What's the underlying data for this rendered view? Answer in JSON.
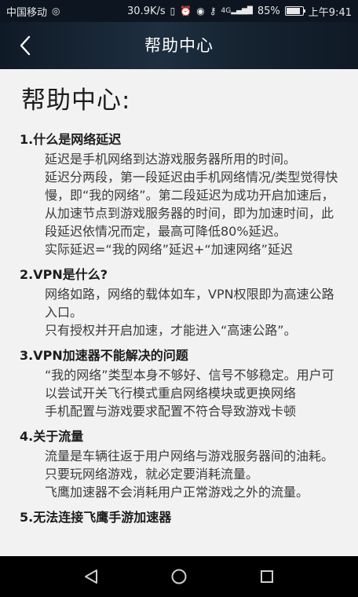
{
  "status_bar": {
    "carrier": "中国移动",
    "speed": "30.9K/s",
    "network": "4G",
    "battery": "85%",
    "battery_level": 0.85,
    "time": "上午9:41"
  },
  "header": {
    "title": "帮助中心"
  },
  "content": {
    "page_title": "帮助中心:",
    "sections": [
      {
        "title": "1.什么是网络延迟",
        "paragraphs": [
          "延迟是手机网络到达游戏服务器所用的时间。",
          "延迟分两段，第一段延迟由手机网络情况/类型觉得快慢，即“我的网络”。第二段延迟为成功开启加速后，从加速节点到游戏服务器的时间，即为加速时间，此段延迟依情况而定，最高可降低80%延迟。",
          "实际延迟=“我的网络”延迟+“加速网络”延迟"
        ]
      },
      {
        "title": "2.VPN是什么?",
        "paragraphs": [
          "网络如路，网络的载体如车，VPN权限即为高速公路入口。",
          "只有授权并开启加速，才能进入“高速公路”。"
        ]
      },
      {
        "title": "3.VPN加速器不能解决的问题",
        "paragraphs": [
          "“我的网络”类型本身不够好、信号不够稳定。用户可以尝试开关飞行模式重启网络模块或更换网络",
          "手机配置与游戏要求配置不符合导致游戏卡顿"
        ]
      },
      {
        "title": "4.关于流量",
        "paragraphs": [
          "流量是车辆往返于用户网络与游戏服务器间的油耗。只要玩网络游戏，就必定要消耗流量。",
          "飞鹰加速器不会消耗用户正常游戏之外的流量。"
        ]
      },
      {
        "title": "5.无法连接飞鹰手游加速器",
        "paragraphs": []
      }
    ]
  }
}
